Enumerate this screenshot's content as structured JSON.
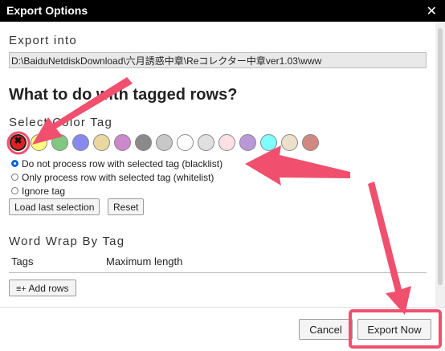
{
  "window": {
    "title": "Export Options",
    "close_glyph": "✕"
  },
  "export_into": {
    "label": "Export into",
    "path": "D:\\BaiduNetdiskDownload\\六月誘惑中章\\Reコレクター中章ver1.03\\www"
  },
  "tagged_rows": {
    "heading": "What to do with tagged rows?",
    "select_color_label": "Select Color Tag",
    "colors": [
      {
        "color": "#e02020",
        "selected": true,
        "mark": "✖"
      },
      {
        "color": "#ffff80",
        "selected": false,
        "mark": ""
      },
      {
        "color": "#80c880",
        "selected": false,
        "mark": ""
      },
      {
        "color": "#8888ee",
        "selected": false,
        "mark": ""
      },
      {
        "color": "#ead8a0",
        "selected": false,
        "mark": ""
      },
      {
        "color": "#cc88cc",
        "selected": false,
        "mark": ""
      },
      {
        "color": "#8a8a8a",
        "selected": false,
        "mark": ""
      },
      {
        "color": "#c8c8c8",
        "selected": false,
        "mark": ""
      },
      {
        "color": "#ffffff",
        "selected": false,
        "mark": ""
      },
      {
        "color": "#e0e0e0",
        "selected": false,
        "mark": ""
      },
      {
        "color": "#fde0e4",
        "selected": false,
        "mark": ""
      },
      {
        "color": "#b898d8",
        "selected": false,
        "mark": ""
      },
      {
        "color": "#80ffff",
        "selected": false,
        "mark": ""
      },
      {
        "color": "#ece0c8",
        "selected": false,
        "mark": ""
      },
      {
        "color": "#d08880",
        "selected": false,
        "mark": ""
      }
    ],
    "options": [
      {
        "label": "Do not process row with selected tag (blacklist)",
        "checked": true
      },
      {
        "label": "Only process row with selected tag (whitelist)",
        "checked": false
      },
      {
        "label": "Ignore tag",
        "checked": false
      }
    ],
    "load_last_label": "Load last selection",
    "reset_label": "Reset"
  },
  "word_wrap": {
    "label": "Word Wrap By Tag",
    "col_tags": "Tags",
    "col_max": "Maximum length",
    "add_rows_icon": "≡+",
    "add_rows_label": "Add rows"
  },
  "footer": {
    "cancel_label": "Cancel",
    "export_label": "Export Now"
  },
  "annotation_color": "#f0506e"
}
